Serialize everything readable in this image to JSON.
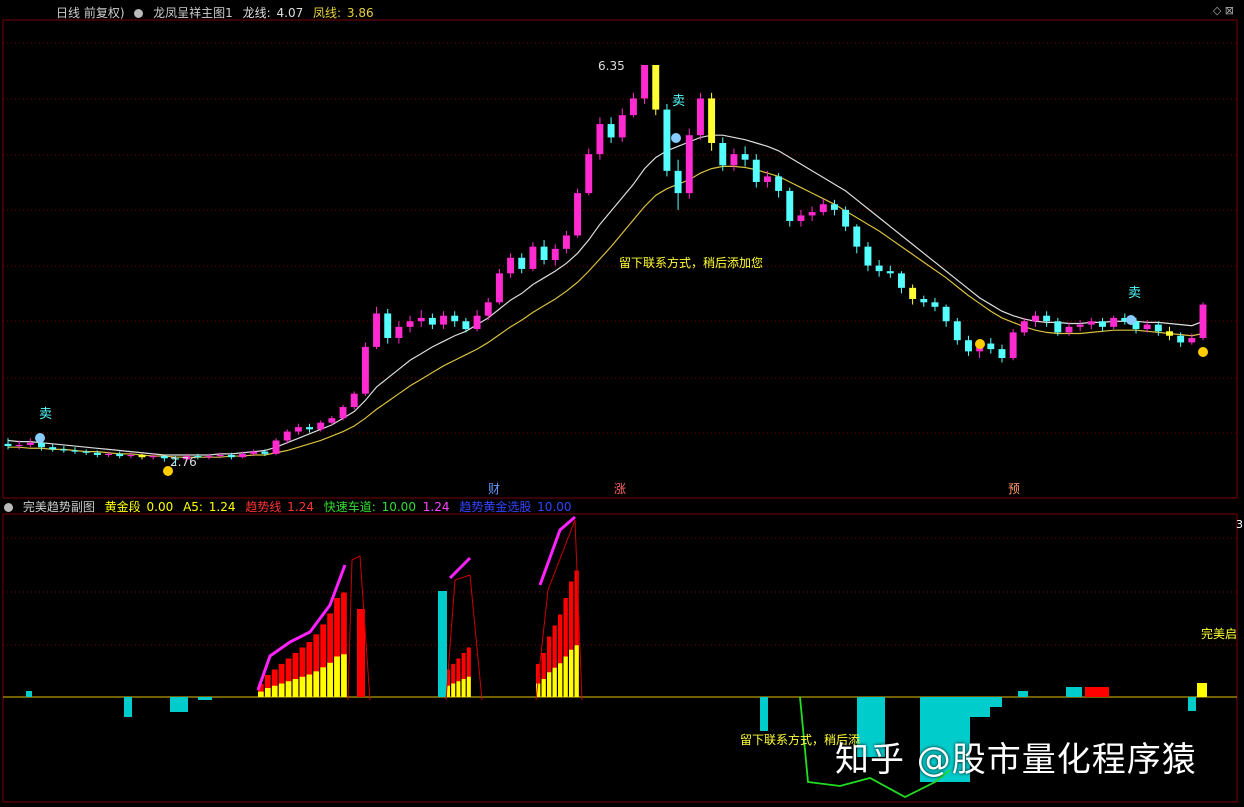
{
  "header": {
    "period": "日线 前复权)",
    "indicator_name": "龙凤呈祥主图1",
    "long_label": "龙线:",
    "long_value": "4.07",
    "phoenix_label": "凤线:",
    "phoenix_value": "3.86"
  },
  "sub_header": {
    "name": "完美趋势副图",
    "gold_label": "黄金段",
    "gold_value": "0.00",
    "a5_label": "A5:",
    "a5_value": "1.24",
    "trend_label": "趋势线",
    "trend_value": "1.24",
    "fast_label": "快速车道:",
    "fast_value": "10.00",
    "fast_value2": "1.24",
    "gold_pick_label": "趋势黄金选股",
    "gold_pick_value": "10.00"
  },
  "annotations": {
    "max_price": "6.35",
    "min_price": "2.76",
    "sell": "卖",
    "notice": "留下联系方式，稍后添加您",
    "notice_sub": "留下联系方式，稍后添",
    "marker_cai": "财",
    "marker_zhang": "涨",
    "marker_yu": "预",
    "perfect_label": "完美启",
    "right_axis_value": "3"
  },
  "watermark": "知乎 @股市量化程序猿",
  "colors": {
    "up": "#ff2bd0",
    "down": "#55ffff",
    "gold_candle": "#ffff33",
    "ma_long": "#dddddd",
    "ma_short": "#d8c040",
    "bar_red": "#ff0000",
    "bar_yellow": "#ffff00",
    "bar_cyan": "#00cccc",
    "curve_magenta": "#ff22ff",
    "curve_green": "#22dd22",
    "grid": "#7a0000"
  },
  "chart_data": {
    "type": "candlestick",
    "price_max": 6.35,
    "price_min": 2.76,
    "candles": [
      [
        2.95,
        2.93,
        3.0,
        2.9
      ],
      [
        2.93,
        2.94,
        2.98,
        2.9
      ],
      [
        2.94,
        2.96,
        3.0,
        2.92
      ],
      [
        2.96,
        2.92,
        2.98,
        2.89
      ],
      [
        2.92,
        2.9,
        2.95,
        2.88
      ],
      [
        2.9,
        2.89,
        2.93,
        2.87
      ],
      [
        2.89,
        2.88,
        2.92,
        2.86
      ],
      [
        2.88,
        2.87,
        2.9,
        2.85
      ],
      [
        2.87,
        2.85,
        2.89,
        2.83
      ],
      [
        2.85,
        2.86,
        2.88,
        2.83
      ],
      [
        2.86,
        2.84,
        2.88,
        2.82
      ],
      [
        2.84,
        2.85,
        2.87,
        2.82
      ],
      [
        2.85,
        2.83,
        2.86,
        2.81
      ],
      [
        2.83,
        2.84,
        2.86,
        2.81
      ],
      [
        2.84,
        2.82,
        2.85,
        2.79
      ],
      [
        2.82,
        2.81,
        2.84,
        2.76
      ],
      [
        2.81,
        2.84,
        2.86,
        2.79
      ],
      [
        2.84,
        2.83,
        2.86,
        2.81
      ],
      [
        2.83,
        2.84,
        2.86,
        2.81
      ],
      [
        2.84,
        2.85,
        2.87,
        2.82
      ],
      [
        2.85,
        2.83,
        2.87,
        2.81
      ],
      [
        2.83,
        2.86,
        2.88,
        2.82
      ],
      [
        2.86,
        2.88,
        2.9,
        2.84
      ],
      [
        2.88,
        2.86,
        2.9,
        2.84
      ],
      [
        2.86,
        2.98,
        3.0,
        2.85
      ],
      [
        2.98,
        3.06,
        3.08,
        2.95
      ],
      [
        3.06,
        3.1,
        3.13,
        3.03
      ],
      [
        3.1,
        3.08,
        3.13,
        3.05
      ],
      [
        3.08,
        3.14,
        3.16,
        3.06
      ],
      [
        3.14,
        3.18,
        3.2,
        3.12
      ],
      [
        3.18,
        3.28,
        3.3,
        3.16
      ],
      [
        3.28,
        3.4,
        3.42,
        3.26
      ],
      [
        3.4,
        3.82,
        3.86,
        3.38
      ],
      [
        3.82,
        4.12,
        4.18,
        3.8
      ],
      [
        4.12,
        3.9,
        4.16,
        3.85
      ],
      [
        3.9,
        4.0,
        4.05,
        3.85
      ],
      [
        4.0,
        4.05,
        4.1,
        3.95
      ],
      [
        4.05,
        4.08,
        4.15,
        4.0
      ],
      [
        4.08,
        4.02,
        4.12,
        3.98
      ],
      [
        4.02,
        4.1,
        4.14,
        3.98
      ],
      [
        4.1,
        4.05,
        4.14,
        4.0
      ],
      [
        4.05,
        3.98,
        4.08,
        3.95
      ],
      [
        3.98,
        4.1,
        4.15,
        3.96
      ],
      [
        4.1,
        4.22,
        4.26,
        4.06
      ],
      [
        4.22,
        4.48,
        4.52,
        4.2
      ],
      [
        4.48,
        4.62,
        4.66,
        4.44
      ],
      [
        4.62,
        4.52,
        4.66,
        4.48
      ],
      [
        4.52,
        4.72,
        4.76,
        4.5
      ],
      [
        4.72,
        4.6,
        4.78,
        4.56
      ],
      [
        4.6,
        4.7,
        4.74,
        4.55
      ],
      [
        4.7,
        4.82,
        4.86,
        4.66
      ],
      [
        4.82,
        5.2,
        5.24,
        4.8
      ],
      [
        5.2,
        5.55,
        5.6,
        5.18
      ],
      [
        5.55,
        5.82,
        5.88,
        5.5
      ],
      [
        5.82,
        5.7,
        5.88,
        5.65
      ],
      [
        5.7,
        5.9,
        5.96,
        5.66
      ],
      [
        5.9,
        6.05,
        6.1,
        5.88
      ],
      [
        6.05,
        6.35,
        6.35,
        6.0
      ],
      [
        6.35,
        5.95,
        6.35,
        5.9
      ],
      [
        5.95,
        5.4,
        6.0,
        5.35
      ],
      [
        5.4,
        5.2,
        5.5,
        5.05
      ],
      [
        5.2,
        5.72,
        5.78,
        5.15
      ],
      [
        5.72,
        6.05,
        6.1,
        5.68
      ],
      [
        6.05,
        5.65,
        6.1,
        5.58
      ],
      [
        5.65,
        5.45,
        5.7,
        5.4
      ],
      [
        5.45,
        5.55,
        5.6,
        5.4
      ],
      [
        5.55,
        5.5,
        5.62,
        5.44
      ],
      [
        5.5,
        5.3,
        5.55,
        5.25
      ],
      [
        5.3,
        5.35,
        5.4,
        5.25
      ],
      [
        5.35,
        5.22,
        5.38,
        5.16
      ],
      [
        5.22,
        4.95,
        5.25,
        4.9
      ],
      [
        4.95,
        5.0,
        5.05,
        4.9
      ],
      [
        5.0,
        5.03,
        5.08,
        4.95
      ],
      [
        5.03,
        5.1,
        5.15,
        5.0
      ],
      [
        5.1,
        5.05,
        5.14,
        5.0
      ],
      [
        5.05,
        4.9,
        5.08,
        4.86
      ],
      [
        4.9,
        4.72,
        4.92,
        4.66
      ],
      [
        4.72,
        4.55,
        4.76,
        4.5
      ],
      [
        4.55,
        4.5,
        4.6,
        4.45
      ],
      [
        4.5,
        4.48,
        4.55,
        4.44
      ],
      [
        4.48,
        4.35,
        4.5,
        4.3
      ],
      [
        4.35,
        4.25,
        4.38,
        4.2
      ],
      [
        4.25,
        4.22,
        4.28,
        4.18
      ],
      [
        4.22,
        4.18,
        4.26,
        4.14
      ],
      [
        4.18,
        4.05,
        4.2,
        4.0
      ],
      [
        4.05,
        3.88,
        4.08,
        3.84
      ],
      [
        3.88,
        3.78,
        3.92,
        3.74
      ],
      [
        3.78,
        3.85,
        3.88,
        3.72
      ],
      [
        3.85,
        3.8,
        3.9,
        3.76
      ],
      [
        3.8,
        3.72,
        3.84,
        3.68
      ],
      [
        3.72,
        3.95,
        3.98,
        3.7
      ],
      [
        3.95,
        4.05,
        4.08,
        3.92
      ],
      [
        4.05,
        4.1,
        4.14,
        4.0
      ],
      [
        4.1,
        4.05,
        4.14,
        4.0
      ],
      [
        4.05,
        3.95,
        4.08,
        3.92
      ],
      [
        3.95,
        4.0,
        4.04,
        3.92
      ],
      [
        4.0,
        4.02,
        4.06,
        3.96
      ],
      [
        4.02,
        4.05,
        4.08,
        3.98
      ],
      [
        4.05,
        4.0,
        4.08,
        3.96
      ],
      [
        4.0,
        4.08,
        4.1,
        3.98
      ],
      [
        4.08,
        4.05,
        4.12,
        4.02
      ],
      [
        4.05,
        3.98,
        4.08,
        3.94
      ],
      [
        3.98,
        4.02,
        4.06,
        3.95
      ],
      [
        4.02,
        3.96,
        4.05,
        3.92
      ],
      [
        3.96,
        3.92,
        4.0,
        3.88
      ],
      [
        3.92,
        3.86,
        3.95,
        3.82
      ],
      [
        3.86,
        3.9,
        3.94,
        3.84
      ],
      [
        3.9,
        4.2,
        4.22,
        3.88
      ]
    ],
    "ma_long": [
      2.98,
      2.97,
      2.97,
      2.96,
      2.95,
      2.94,
      2.93,
      2.92,
      2.91,
      2.9,
      2.89,
      2.88,
      2.87,
      2.86,
      2.85,
      2.85,
      2.85,
      2.85,
      2.85,
      2.86,
      2.86,
      2.87,
      2.88,
      2.89,
      2.92,
      2.96,
      3.0,
      3.04,
      3.08,
      3.12,
      3.18,
      3.24,
      3.34,
      3.46,
      3.54,
      3.62,
      3.7,
      3.76,
      3.82,
      3.87,
      3.92,
      3.96,
      4.02,
      4.08,
      4.16,
      4.24,
      4.3,
      4.38,
      4.44,
      4.5,
      4.57,
      4.66,
      4.78,
      4.92,
      5.04,
      5.16,
      5.28,
      5.42,
      5.52,
      5.58,
      5.62,
      5.66,
      5.7,
      5.72,
      5.72,
      5.7,
      5.68,
      5.65,
      5.62,
      5.58,
      5.52,
      5.46,
      5.4,
      5.34,
      5.28,
      5.22,
      5.14,
      5.06,
      4.98,
      4.9,
      4.82,
      4.74,
      4.66,
      4.58,
      4.5,
      4.42,
      4.34,
      4.26,
      4.2,
      4.14,
      4.1,
      4.07,
      4.05,
      4.04,
      4.04,
      4.03,
      4.03,
      4.04,
      4.04,
      4.05,
      4.05,
      4.05,
      4.04,
      4.04,
      4.03,
      4.02,
      4.01,
      4.05
    ],
    "ma_short": [
      2.92,
      2.92,
      2.91,
      2.91,
      2.9,
      2.9,
      2.89,
      2.88,
      2.88,
      2.87,
      2.86,
      2.86,
      2.85,
      2.84,
      2.84,
      2.83,
      2.83,
      2.83,
      2.83,
      2.83,
      2.84,
      2.84,
      2.85,
      2.85,
      2.87,
      2.89,
      2.92,
      2.95,
      2.98,
      3.02,
      3.06,
      3.11,
      3.18,
      3.26,
      3.33,
      3.4,
      3.47,
      3.53,
      3.59,
      3.65,
      3.7,
      3.75,
      3.8,
      3.86,
      3.93,
      4.0,
      4.06,
      4.13,
      4.19,
      4.25,
      4.32,
      4.4,
      4.5,
      4.61,
      4.72,
      4.84,
      4.96,
      5.08,
      5.18,
      5.24,
      5.28,
      5.32,
      5.38,
      5.42,
      5.44,
      5.44,
      5.43,
      5.41,
      5.38,
      5.35,
      5.3,
      5.25,
      5.2,
      5.15,
      5.1,
      5.04,
      4.98,
      4.92,
      4.86,
      4.79,
      4.72,
      4.65,
      4.58,
      4.51,
      4.44,
      4.36,
      4.28,
      4.21,
      4.14,
      4.08,
      4.04,
      4.0,
      3.97,
      3.95,
      3.94,
      3.94,
      3.94,
      3.95,
      3.96,
      3.97,
      3.97,
      3.97,
      3.96,
      3.95,
      3.94,
      3.93,
      3.92,
      3.94
    ]
  }
}
